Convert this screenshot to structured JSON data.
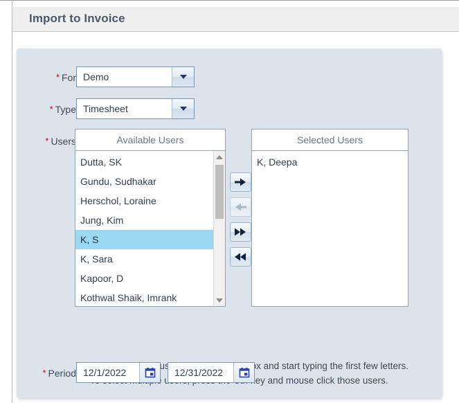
{
  "window": {
    "title": "Import to Invoice"
  },
  "form": {
    "for": {
      "label": "For",
      "value": "Demo",
      "required_mark": "*"
    },
    "type": {
      "label": "Type",
      "value": "Timesheet",
      "required_mark": "*"
    },
    "users": {
      "label": "Users",
      "required_mark": "*",
      "available_header": "Available Users",
      "selected_header": "Selected Users",
      "available": [
        "Dutta, SK",
        "Gundu, Sudhakar",
        "Herschol, Loraine",
        "Jung, Kim",
        "K, S",
        "K, Sara",
        "Kapoor, D",
        "Kothwal Shaik, Imrank"
      ],
      "available_selected_index": 4,
      "selected": [
        "K, Deepa"
      ],
      "transfer_buttons": [
        {
          "name": "move-right-button",
          "glyph": "single-right-arrow-icon",
          "enabled": true
        },
        {
          "name": "move-left-button",
          "glyph": "single-left-arrow-icon",
          "enabled": false
        },
        {
          "name": "move-all-right-button",
          "glyph": "double-right-arrow-icon",
          "enabled": true
        },
        {
          "name": "move-all-left-button",
          "glyph": "double-left-arrow-icon",
          "enabled": true
        }
      ]
    },
    "hints": [
      "To search for an user, click on the list box and start typing the first few letters.",
      "To select multiple users, press the Ctrl key and mouse click those users."
    ],
    "period": {
      "label": "Period",
      "required_mark": "*",
      "start_date": "12/1/2022",
      "end_date": "12/31/2022",
      "calendar_icon": "calendar-icon"
    }
  },
  "colors": {
    "panel_background": "#dde3ea",
    "title_background": "#efefef",
    "title_text": "#4a5a6a",
    "required_star": "#d0021b",
    "selection_highlight": "#9ad9ef",
    "field_border": "#7a93ae",
    "accent_bar": "#c8833c",
    "calendar_blue": "#2a3fa8"
  }
}
